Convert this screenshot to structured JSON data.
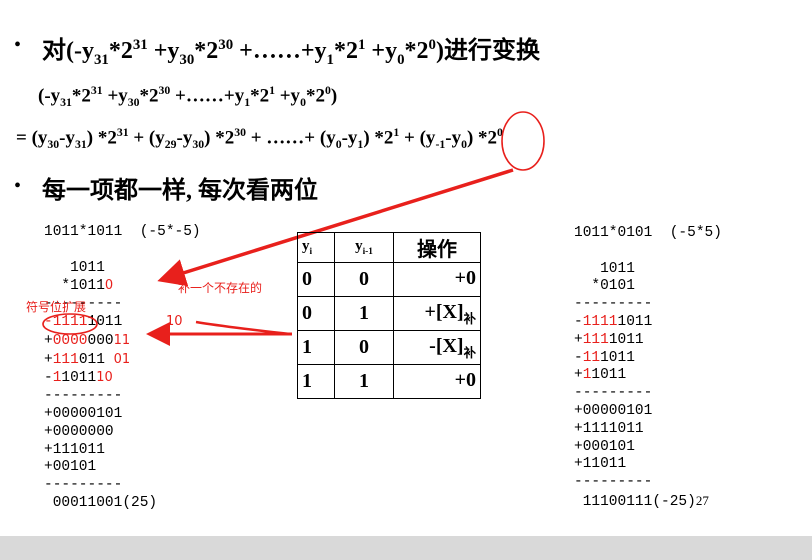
{
  "bullet_char": "•",
  "heading1": {
    "prefix": "对(-y",
    "s31": "31",
    "p1": "*2",
    "e31": "31",
    "p2": " +y",
    "s30": "30",
    "p3": "*2",
    "e30": "30",
    "p4": " +……+y",
    "s1": "1",
    "p5": "*2",
    "e1": "1",
    "p6": " +y",
    "s0": "0",
    "p7": "*2",
    "e0": "0",
    "suffix": ")进行变换"
  },
  "line2": {
    "a": "(-y",
    "s31": "31",
    "b": "*2",
    "e31": "31",
    "c": " +y",
    "s30": "30",
    "d": "*2",
    "e30": "30",
    "e": " +……+y",
    "s1": "1",
    "f": "*2",
    "e1": "1",
    "g": " +y",
    "s0": "0",
    "h": "*2",
    "e0": "0",
    "i": ")"
  },
  "line3": {
    "a": "= (y",
    "s30": "30",
    "b": "-y",
    "s31": "31",
    "c": ") *2",
    "e31": "31",
    "d": " + (y",
    "s29": "29",
    "e": "-y",
    "s30b": "30",
    "f": ") *2",
    "e30": "30",
    "g": " + ……+ (y",
    "s0": "0",
    "h": "-y",
    "s1": "1",
    "i": ") *2",
    "e1": "1",
    "j": " + (y",
    "sm1": "-1",
    "k": "-y",
    "s0b": "0",
    "l": ") *2",
    "e0": "0"
  },
  "heading2": "每一项都一样, 每次看两位",
  "left_calc": {
    "title": "1011*1011  (-5*-5)",
    "multiplicand": "1011",
    "multiplier": "*1011",
    "multiplier_extra": "0",
    "sep": "---------",
    "r1_red": "-1111",
    "r1_black": "1011",
    "r2_pre": "+",
    "r2_red": "0000",
    "r2_black": "000",
    "r2_note": "11",
    "r3_pre": "+",
    "r3_red": "111",
    "r3_black": "011",
    "r3_note": "01",
    "r4_pre": "-",
    "r4_red": "1",
    "r4_black": "1011",
    "r4_note": "10",
    "sep2": "---------",
    "s1": "+00000101",
    "s2": "+0000000",
    "s3": "+111011",
    "s4": "+00101",
    "sep3": "---------",
    "result": "00011001(25)"
  },
  "annotations": {
    "pad_zero": "补一个不存在的",
    "sign_ext": "符号位扩展",
    "ten": "10"
  },
  "table": {
    "headers": [
      "y",
      "y",
      "操作"
    ],
    "header_subs": [
      "i",
      "i-1",
      ""
    ],
    "rows": [
      {
        "yi": "0",
        "yi1": "0",
        "op": "+0",
        "sub": ""
      },
      {
        "yi": "0",
        "yi1": "1",
        "op": "+[X]",
        "sub": "补"
      },
      {
        "yi": "1",
        "yi1": "0",
        "op": "-[X]",
        "sub": "补"
      },
      {
        "yi": "1",
        "yi1": "1",
        "op": "+0",
        "sub": ""
      }
    ]
  },
  "right_calc": {
    "title": "1011*0101  (-5*5)",
    "multiplicand": "1011",
    "multiplier": "*0101",
    "sep": "---------",
    "r1_pre": "-",
    "r1_red": "1111",
    "r1_black": "1011",
    "r2_pre": "+",
    "r2_red": "111",
    "r2_black": "1011",
    "r3_pre": "-",
    "r3_red": "11",
    "r3_black": "1011",
    "r4_pre": "+",
    "r4_red": "1",
    "r4_black": "1011",
    "sep2": "---------",
    "s1": "+00000101",
    "s2": "+1111011",
    "s3": "+000101",
    "s4": "+11011",
    "sep3": "---------",
    "result": "11100111(-25)"
  },
  "page_number": "27"
}
